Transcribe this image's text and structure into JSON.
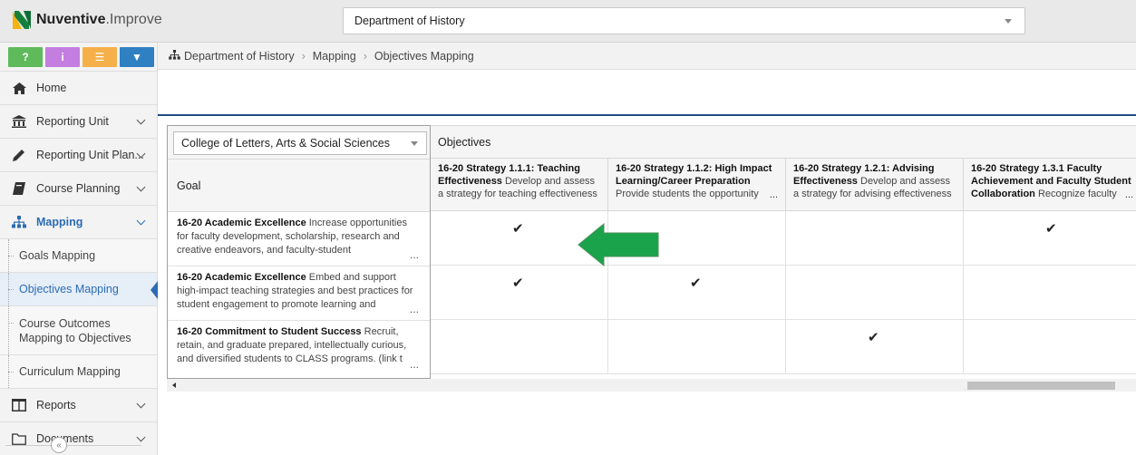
{
  "app": {
    "brand": "Nuventive",
    "product": ".Improve"
  },
  "top": {
    "department_select": "Department of History"
  },
  "quick_buttons": [
    "?",
    "i",
    "☰",
    "▼"
  ],
  "sidebar": {
    "items": [
      {
        "label": "Home",
        "icon": "home-icon"
      },
      {
        "label": "Reporting Unit",
        "icon": "bank-icon"
      },
      {
        "label": "Reporting Unit Plan...",
        "icon": "pencil-icon"
      },
      {
        "label": "Course Planning",
        "icon": "book-icon"
      },
      {
        "label": "Mapping",
        "icon": "sitemap-icon"
      }
    ],
    "sub_items": [
      {
        "label": "Goals Mapping"
      },
      {
        "label": "Objectives Mapping"
      },
      {
        "label": "Course Outcomes Mapping to Objectives"
      },
      {
        "label": "Curriculum Mapping"
      }
    ],
    "bottom_items": [
      {
        "label": "Reports",
        "icon": "columns-icon"
      },
      {
        "label": "Documents",
        "icon": "folder-icon"
      }
    ],
    "collapse_glyph": "«"
  },
  "breadcrumb": [
    "Department of History",
    "Mapping",
    "Objectives Mapping"
  ],
  "grid": {
    "college_select": "College of Letters, Arts & Social Sciences",
    "objectives_label": "Objectives",
    "goal_header": "Goal",
    "objectives": [
      {
        "title": "16-20 Strategy 1.1.1: Teaching Effectiveness",
        "desc": "Develop and assess a strategy for teaching effectiveness"
      },
      {
        "title": "16-20 Strategy 1.1.2: High Impact Learning/Career Preparation",
        "desc": "Provide students the opportunity"
      },
      {
        "title": "16-20 Strategy 1.2.1: Advising Effectiveness",
        "desc": "Develop and assess a strategy for advising effectiveness"
      },
      {
        "title": "16-20 Strategy 1.3.1 Faculty Achievement and Faculty Student Collaboration",
        "desc": "Recognize faculty"
      }
    ],
    "goals": [
      {
        "title": "16-20 Academic Excellence",
        "desc": "Increase opportunities for faculty development, scholarship, research and creative endeavors, and faculty-student"
      },
      {
        "title": "16-20 Academic Excellence",
        "desc": "Embed and support high-impact teaching strategies and best practices for student engagement to promote learning and"
      },
      {
        "title": "16-20 Commitment to Student Success",
        "desc": "Recruit, retain, and graduate prepared, intellectually curious, and diversified students to CLASS programs. (link t"
      }
    ],
    "matrix": [
      [
        true,
        false,
        false,
        true
      ],
      [
        true,
        true,
        false,
        false
      ],
      [
        false,
        false,
        true,
        false
      ]
    ],
    "check_glyph": "✔",
    "ellipsis": "..."
  },
  "colors": {
    "accent": "#2a6cb5",
    "navy_line": "#1e4e86",
    "arrow": "#1aa34a"
  }
}
